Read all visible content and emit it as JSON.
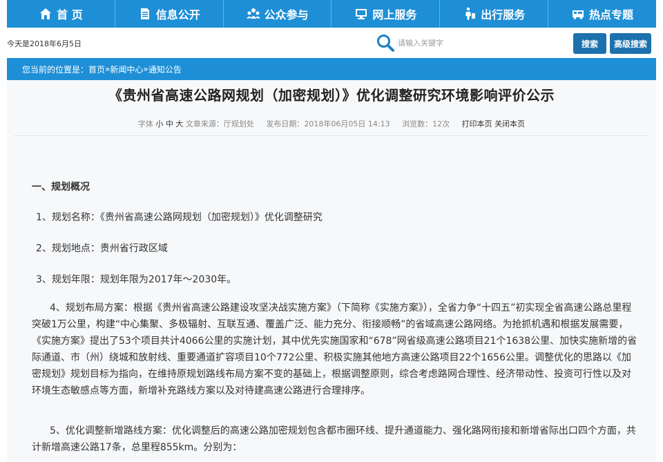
{
  "nav": {
    "items": [
      {
        "label": "首 页",
        "icon": "home-icon"
      },
      {
        "label": "信息公开",
        "icon": "document-icon"
      },
      {
        "label": "公众参与",
        "icon": "people-icon"
      },
      {
        "label": "网上服务",
        "icon": "monitor-icon"
      },
      {
        "label": "出行服务",
        "icon": "traveler-icon"
      },
      {
        "label": "热点专题",
        "icon": "bus-icon"
      }
    ]
  },
  "header": {
    "date_text": "今天是2018年6月5日",
    "search_placeholder": "请输入关键字",
    "search_button": "搜索",
    "advanced_button": "高级搜索"
  },
  "breadcrumb": {
    "prefix": "您当前的位置是：",
    "items": [
      "首页",
      "新闻中心",
      "通知公告"
    ],
    "separator": " » "
  },
  "article": {
    "title": "《贵州省高速公路网规划（加密规划）》优化调整研究环境影响评价公示",
    "meta": {
      "font_label": "字体",
      "size_small": "小",
      "size_medium": "中",
      "size_large": "大",
      "source": "文章来源：厅规划处",
      "publish_date": "发布日期：2018年06月05日 14:13",
      "views": "浏览数：12次",
      "print": "打印本页",
      "close": "关闭本页"
    },
    "section_heading": "一、规划概况",
    "paragraphs": [
      "1、规划名称：《贵州省高速公路网规划（加密规划）》优化调整研究",
      "2、规划地点：贵州省行政区域",
      "3、规划年限：规划年限为2017年～2030年。",
      "4、规划布局方案：根据《贵州省高速公路建设攻坚决战实施方案》（下简称《实施方案》），全省力争“十四五”初实现全省高速公路总里程突破1万公里，构建“中心集聚、多极辐射、互联互通、覆盖广泛、能力充分、衔接顺畅”的省域高速公路网络。为抢抓机遇和根据发展需要，《实施方案》提出了53个项目共计4066公里的实施计划，其中优先实施国家和“678”网省级高速公路项目21个1638公里、加快实施新增的省际通道、市（州）绕城和放射线、重要通道扩容项目10个772公里、积极实施其他地方高速公路项目22个1656公里。调整优化的思路以《加密规划》规划目标为指向，在维持原规划路线布局方案不变的基础上，根据调整原则，综合考虑路网合理性、经济带动性、投资可行性以及对环境生态敏感点等方面，新增补充路线方案以及对待建高速公路进行合理排序。",
      "5、优化调整新增路线方案：优化调整后的高速公路加密规划包含都市圈环线、提升通道能力、强化路网衔接和新增省际出口四个方面，共计新增高速公路17条，总里程855km。分别为："
    ]
  },
  "colors": {
    "nav_bg": "#1e8fd6",
    "button_bg": "#1c71ad",
    "panel_bg": "#f7f8fa"
  }
}
